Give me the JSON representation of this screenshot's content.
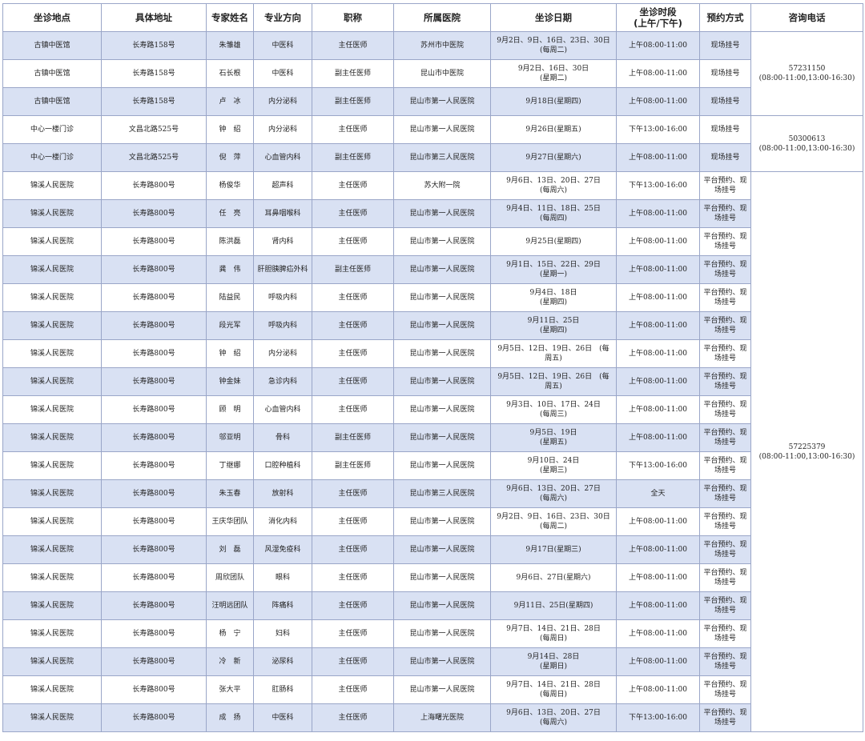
{
  "headers": [
    "坐诊地点",
    "具体地址",
    "专家姓名",
    "专业方向",
    "职称",
    "所属医院",
    "坐诊日期",
    "坐诊时段\n(上午/下午)",
    "预约方式",
    "咨询电话"
  ],
  "groups": [
    {
      "phone": "57231150\n(08:00-11:00,13:00-16:30)",
      "rows": [
        {
          "loc": "古镇中医馆",
          "addr": "长寿路158号",
          "name": "朱雏雄",
          "dept": "中医科",
          "title": "主任医师",
          "hosp": "苏州市中医院",
          "date": "9月2日、9日、16日、23日、30日\n(每周二)",
          "time": "上午08:00-11:00",
          "book": "现场挂号"
        },
        {
          "loc": "古镇中医馆",
          "addr": "长寿路158号",
          "name": "石长根",
          "dept": "中医科",
          "title": "副主任医师",
          "hosp": "昆山市中医院",
          "date": "9月2日、16日、30日\n(星期二)",
          "time": "上午08:00-11:00",
          "book": "现场挂号"
        },
        {
          "loc": "古镇中医馆",
          "addr": "长寿路158号",
          "name": "卢　冰",
          "dept": "内分泌科",
          "title": "副主任医师",
          "hosp": "昆山市第一人民医院",
          "date": "9月18日(星期四)",
          "time": "上午08:00-11:00",
          "book": "现场挂号"
        }
      ]
    },
    {
      "phone": "50300613\n(08:00-11:00,13:00-16:30)",
      "rows": [
        {
          "loc": "中心一楼门诊",
          "addr": "文昌北路525号",
          "name": "钟　绍",
          "dept": "内分泌科",
          "title": "主任医师",
          "hosp": "昆山市第一人民医院",
          "date": "9月26日(星期五)",
          "time": "下午13:00-16:00",
          "book": "现场挂号"
        },
        {
          "loc": "中心一楼门诊",
          "addr": "文昌北路525号",
          "name": "倪　萍",
          "dept": "心血管内科",
          "title": "副主任医师",
          "hosp": "昆山市第三人民医院",
          "date": "9月27日(星期六)",
          "time": "上午08:00-11:00",
          "book": "现场挂号"
        }
      ]
    },
    {
      "phone": "57225379\n(08:00-11:00,13:00-16:30)",
      "rows": [
        {
          "loc": "锦溪人民医院",
          "addr": "长寿路800号",
          "name": "杨俊华",
          "dept": "超声科",
          "title": "主任医师",
          "hosp": "苏大附一院",
          "date": "9月6日、13日、20日、27日\n(每周六)",
          "time": "下午13:00-16:00",
          "book": "平台预约、现\n场挂号"
        },
        {
          "loc": "锦溪人民医院",
          "addr": "长寿路800号",
          "name": "任　亮",
          "dept": "耳鼻咽喉科",
          "title": "主任医师",
          "hosp": "昆山市第一人民医院",
          "date": "9月4日、11日、18日、25日\n(每周四)",
          "time": "上午08:00-11:00",
          "book": "平台预约、现\n场挂号"
        },
        {
          "loc": "锦溪人民医院",
          "addr": "长寿路800号",
          "name": "陈洪磊",
          "dept": "肾内科",
          "title": "主任医师",
          "hosp": "昆山市第一人民医院",
          "date": "9月25日(星期四)",
          "time": "上午08:00-11:00",
          "book": "平台预约、现\n场挂号"
        },
        {
          "loc": "锦溪人民医院",
          "addr": "长寿路800号",
          "name": "龚　伟",
          "dept": "肝胆胰脾疝外科",
          "title": "副主任医师",
          "hosp": "昆山市第一人民医院",
          "date": "9月1日、15日、22日、29日\n(星期一)",
          "time": "上午08:00-11:00",
          "book": "平台预约、现\n场挂号"
        },
        {
          "loc": "锦溪人民医院",
          "addr": "长寿路800号",
          "name": "陆益民",
          "dept": "呼吸内科",
          "title": "主任医师",
          "hosp": "昆山市第一人民医院",
          "date": "9月4日、18日\n(星期四)",
          "time": "上午08:00-11:00",
          "book": "平台预约、现\n场挂号"
        },
        {
          "loc": "锦溪人民医院",
          "addr": "长寿路800号",
          "name": "段光军",
          "dept": "呼吸内科",
          "title": "主任医师",
          "hosp": "昆山市第一人民医院",
          "date": "9月11日、25日\n(星期四)",
          "time": "上午08:00-11:00",
          "book": "平台预约、现\n场挂号"
        },
        {
          "loc": "锦溪人民医院",
          "addr": "长寿路800号",
          "name": "钟　绍",
          "dept": "内分泌科",
          "title": "主任医师",
          "hosp": "昆山市第一人民医院",
          "date": "9月5日、12日、19日、26日　(每\n周五)",
          "time": "上午08:00-11:00",
          "book": "平台预约、现\n场挂号"
        },
        {
          "loc": "锦溪人民医院",
          "addr": "长寿路800号",
          "name": "钟金妹",
          "dept": "急诊内科",
          "title": "主任医师",
          "hosp": "昆山市第一人民医院",
          "date": "9月5日、12日、19日、26日　(每\n周五)",
          "time": "上午08:00-11:00",
          "book": "平台预约、现\n场挂号"
        },
        {
          "loc": "锦溪人民医院",
          "addr": "长寿路800号",
          "name": "顾　明",
          "dept": "心血管内科",
          "title": "主任医师",
          "hosp": "昆山市第一人民医院",
          "date": "9月3日、10日、17日、24日\n(每周三)",
          "time": "上午08:00-11:00",
          "book": "平台预约、现\n场挂号"
        },
        {
          "loc": "锦溪人民医院",
          "addr": "长寿路800号",
          "name": "邬亚明",
          "dept": "骨科",
          "title": "副主任医师",
          "hosp": "昆山市第一人民医院",
          "date": "9月5日、19日\n(星期五)",
          "time": "上午08:00-11:00",
          "book": "平台预约、现\n场挂号"
        },
        {
          "loc": "锦溪人民医院",
          "addr": "长寿路800号",
          "name": "丁继娜",
          "dept": "口腔种植科",
          "title": "副主任医师",
          "hosp": "昆山市第一人民医院",
          "date": "9月10日、24日\n(星期三)",
          "time": "下午13:00-16:00",
          "book": "平台预约、现\n场挂号"
        },
        {
          "loc": "锦溪人民医院",
          "addr": "长寿路800号",
          "name": "朱玉春",
          "dept": "放射科",
          "title": "主任医师",
          "hosp": "昆山市第三人民医院",
          "date": "9月6日、13日、20日、27日\n(每周六)",
          "time": "全天",
          "book": "平台预约、现\n场挂号"
        },
        {
          "loc": "锦溪人民医院",
          "addr": "长寿路800号",
          "name": "王庆华团队",
          "dept": "消化内科",
          "title": "主任医师",
          "hosp": "昆山市第一人民医院",
          "date": "9月2日、9日、16日、23日、30日\n(每周二)",
          "time": "上午08:00-11:00",
          "book": "平台预约、现\n场挂号"
        },
        {
          "loc": "锦溪人民医院",
          "addr": "长寿路800号",
          "name": "刘　磊",
          "dept": "风湿免疫科",
          "title": "主任医师",
          "hosp": "昆山市第一人民医院",
          "date": "9月17日(星期三)",
          "time": "上午08:00-11:00",
          "book": "平台预约、现\n场挂号"
        },
        {
          "loc": "锦溪人民医院",
          "addr": "长寿路800号",
          "name": "周欣团队",
          "dept": "眼科",
          "title": "主任医师",
          "hosp": "昆山市第一人民医院",
          "date": "9月6日、27日(星期六)",
          "time": "上午08:00-11:00",
          "book": "平台预约、现\n场挂号"
        },
        {
          "loc": "锦溪人民医院",
          "addr": "长寿路800号",
          "name": "汪明远团队",
          "dept": "阵痛科",
          "title": "主任医师",
          "hosp": "昆山市第一人民医院",
          "date": "9月11日、25日(星期四)",
          "time": "上午08:00-11:00",
          "book": "平台预约、现\n场挂号"
        },
        {
          "loc": "锦溪人民医院",
          "addr": "长寿路800号",
          "name": "杨　宁",
          "dept": "妇科",
          "title": "主任医师",
          "hosp": "昆山市第一人民医院",
          "date": "9月7日、14日、21日、28日\n(每周日)",
          "time": "上午08:00-11:00",
          "book": "平台预约、现\n场挂号"
        },
        {
          "loc": "锦溪人民医院",
          "addr": "长寿路800号",
          "name": "冷　新",
          "dept": "泌尿科",
          "title": "主任医师",
          "hosp": "昆山市第一人民医院",
          "date": "9月14日、28日\n(星期日)",
          "time": "上午08:00-11:00",
          "book": "平台预约、现\n场挂号"
        },
        {
          "loc": "锦溪人民医院",
          "addr": "长寿路800号",
          "name": "张大平",
          "dept": "肛肠科",
          "title": "主任医师",
          "hosp": "昆山市第一人民医院",
          "date": "9月7日、14日、21日、28日\n(每周日)",
          "time": "上午08:00-11:00",
          "book": "平台预约、现\n场挂号"
        },
        {
          "loc": "锦溪人民医院",
          "addr": "长寿路800号",
          "name": "成　扬",
          "dept": "中医科",
          "title": "主任医师",
          "hosp": "上海曙光医院",
          "date": "9月6日、13日、20日、27日\n(每周六)",
          "time": "下午13:00-16:00",
          "book": "平台预约、现\n场挂号"
        }
      ]
    }
  ]
}
